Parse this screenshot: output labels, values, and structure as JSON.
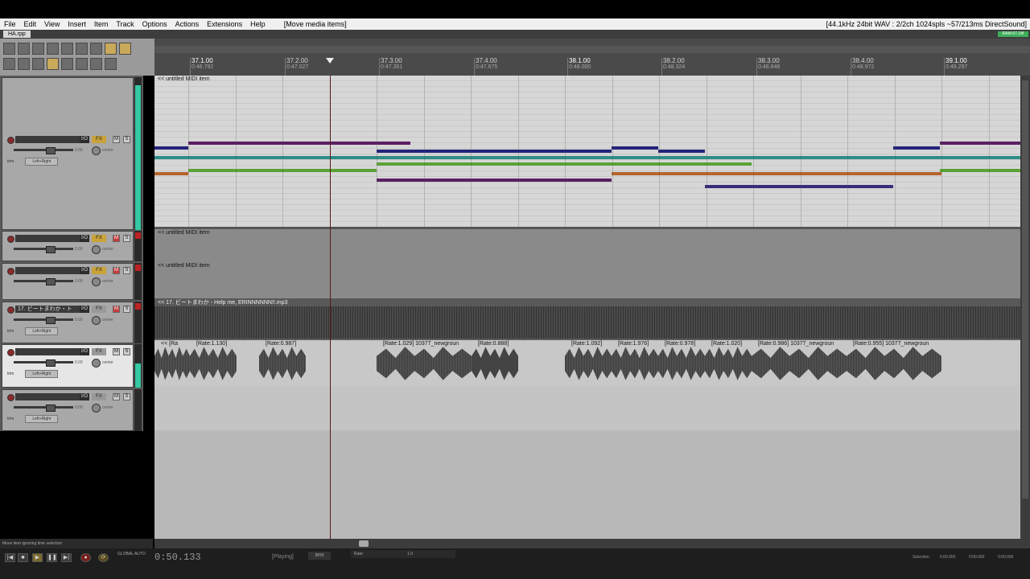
{
  "menu": [
    "File",
    "Edit",
    "View",
    "Insert",
    "Item",
    "Track",
    "Options",
    "Actions",
    "Extensions",
    "Help"
  ],
  "last_action": "[Move media items]",
  "status": "[44.1kHz 24bit WAV : 2/2ch 1024spls ~57/213ms DirectSound]",
  "project_tab": "HA.rpp",
  "perf_label": "RAM 67.1M",
  "ruler": {
    "markers": [
      {
        "bar": "37.1.00",
        "time": "0:46.792",
        "major": true
      },
      {
        "bar": "37.2.00",
        "time": "0:47.027",
        "major": false
      },
      {
        "bar": "37.3.00",
        "time": "0:47.351",
        "major": false
      },
      {
        "bar": "37.4.00",
        "time": "0:47.675",
        "major": false
      },
      {
        "bar": "38.1.00",
        "time": "0:48.000",
        "major": true
      },
      {
        "bar": "38.2.00",
        "time": "0:48.324",
        "major": false
      },
      {
        "bar": "38.3.00",
        "time": "0:48.648",
        "major": false
      },
      {
        "bar": "38.4.00",
        "time": "0:48.972",
        "major": false
      },
      {
        "bar": "39.1.00",
        "time": "0:49.297",
        "major": true
      }
    ]
  },
  "tracks": [
    {
      "name": "",
      "io": "I/O",
      "fx": "FX",
      "m": "M",
      "s": "S",
      "vol": "0.00",
      "pan": "center",
      "mode": "trim",
      "routing": "Left+Right",
      "meter": 0.95,
      "fx_on": true
    },
    {
      "name": "",
      "io": "I/O",
      "fx": "FX",
      "m": "M",
      "s": "S",
      "vol": "0.00",
      "pan": "center",
      "mode": "",
      "routing": "",
      "meter": 0,
      "fx_on": true
    },
    {
      "name": "",
      "io": "I/O",
      "fx": "FX",
      "m": "M",
      "s": "S",
      "vol": "0.00",
      "pan": "center",
      "mode": "",
      "routing": "",
      "meter": 0,
      "fx_on": true
    },
    {
      "name": "17. ビートまわか・ト",
      "io": "I/O",
      "fx": "FX",
      "m": "M",
      "s": "S",
      "vol": "0.00",
      "pan": "center",
      "mode": "trim",
      "routing": "Left+Right",
      "meter": 0,
      "fx_on": false
    },
    {
      "name": "",
      "io": "I/O",
      "fx": "FX",
      "m": "M",
      "s": "S",
      "vol": "0.00",
      "pan": "center",
      "mode": "trim",
      "routing": "Left+Right",
      "meter": 0.55,
      "fx_on": false
    },
    {
      "name": "",
      "io": "I/O",
      "fx": "FX",
      "m": "M",
      "s": "S",
      "vol": "0.00",
      "pan": "center",
      "mode": "trim",
      "routing": "Left+Right",
      "meter": 0,
      "fx_on": false
    }
  ],
  "items": {
    "midi1": "<< untitled MIDI item",
    "midi2": "<< untitled MIDI item",
    "midi3": "<< untitled MIDI item",
    "audio": "<< 17. ビートまわか - Help me, ERINNNNNN!!.mp3",
    "clips": [
      "<< [Ra",
      "[Rate:1.130]",
      "[Rate:0.987]",
      "[Rate:1.029] 10377_newgroun",
      "[Rate:0.888]",
      "[Rate:1.092]",
      "[Rate:1.976]",
      "[Rate:0.978]",
      "[Rate:1.020]",
      "[Rate:0.986] 10377_newgroun",
      "[Rate:0.955] 10377_newgroun"
    ]
  },
  "notes_colors": {
    "purple": "#5a1f63",
    "navy": "#23237a",
    "teal": "#2f8c86",
    "green": "#5aa236",
    "orange": "#b5642c",
    "violet": "#3a2a7a"
  },
  "hint": "Move item ignoring time selection",
  "transport": {
    "time": "0:50.133",
    "state": "[Playing]",
    "bpm_label": "BPM",
    "rate_label": "Rate:",
    "rate_value": "1.0",
    "global_auto": "GLOBAL AUTO",
    "selection_label": "Selection:",
    "sel_start": "0:00.000",
    "sel_end": "0:00.000",
    "sel_len": "0:00.000"
  }
}
